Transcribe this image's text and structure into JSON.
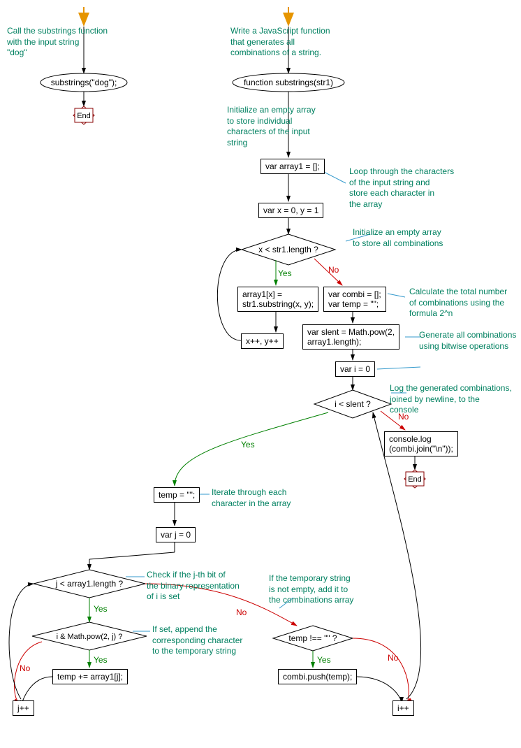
{
  "left_flow": {
    "ann1": "Call the substrings function\nwith the input string\n\"dog\"",
    "start": "substrings(\"dog\");",
    "end": "End"
  },
  "main": {
    "ann_title": "Write a JavaScript function\nthat generates all\ncombinations of a string.",
    "start": "function substrings(str1)",
    "ann_init_array": "Initialize an empty array\nto store individual\ncharacters of the input\nstring",
    "box_array1": "var array1 = [];",
    "ann_loop_chars": "Loop through the characters\nof the input string and\nstore each character in\nthe array",
    "box_xy": "var x = 0, y = 1",
    "dec_xlen": "x < str1.length ?",
    "yes": "Yes",
    "no": "No",
    "box_array_assign": "array1[x] =\nstr1.substring(x, y);",
    "box_xypp": "x++, y++",
    "ann_init_combi": "Initialize an empty array\nto store all combinations",
    "box_combi": "var combi = [];\nvar temp = \"\";",
    "ann_slent": "Calculate the total number\nof combinations using the\nformula 2^n",
    "box_slent": "var slent = Math.pow(2,\narray1.length);",
    "ann_gen": "Generate all combinations\nusing bitwise operations",
    "box_i0": "var i = 0",
    "dec_islent": "i < slent ?",
    "ann_log": "Log the generated combinations,\njoined by newline, to the\nconsole",
    "box_log": "console.log\n(combi.join(\"\\n\"));",
    "end": "End",
    "box_temp": "temp = \"\";",
    "ann_iter": "Iterate through each\ncharacter in the array",
    "box_j0": "var j = 0",
    "dec_jlen": "j < array1.length ?",
    "ann_checkbit": "Check if the j-th bit of\nthe binary representation\nof i is set",
    "dec_bit": "i & Math.pow(2, j) ?",
    "ann_append": "If set, append the\ncorresponding character\nto the temporary string",
    "box_append": "temp += array1[j];",
    "box_jpp": "j++",
    "ann_tempne": "If the temporary string\nis not empty, add it to\nthe combinations array",
    "dec_tempne": "temp !== \"\" ?",
    "box_push": "combi.push(temp);",
    "box_ipp": "i++"
  },
  "chart_data": {
    "type": "flowchart",
    "title": "JavaScript substrings/combinations flowchart",
    "nodes": [
      {
        "id": "A",
        "type": "terminator",
        "label": "substrings(\"dog\");"
      },
      {
        "id": "A_end",
        "type": "end",
        "label": "End"
      },
      {
        "id": "S",
        "type": "terminator",
        "label": "function substrings(str1)"
      },
      {
        "id": "N1",
        "type": "process",
        "label": "var array1 = [];"
      },
      {
        "id": "N2",
        "type": "process",
        "label": "var x = 0, y = 1"
      },
      {
        "id": "D1",
        "type": "decision",
        "label": "x < str1.length ?"
      },
      {
        "id": "N3",
        "type": "process",
        "label": "array1[x] = str1.substring(x, y);"
      },
      {
        "id": "N4",
        "type": "process",
        "label": "x++, y++"
      },
      {
        "id": "N5",
        "type": "process",
        "label": "var combi = []; var temp = \"\";"
      },
      {
        "id": "N6",
        "type": "process",
        "label": "var slent = Math.pow(2, array1.length);"
      },
      {
        "id": "N7",
        "type": "process",
        "label": "var i = 0"
      },
      {
        "id": "D2",
        "type": "decision",
        "label": "i < slent ?"
      },
      {
        "id": "N8",
        "type": "process",
        "label": "console.log(combi.join(\"\\n\"));"
      },
      {
        "id": "E2",
        "type": "end",
        "label": "End"
      },
      {
        "id": "N9",
        "type": "process",
        "label": "temp = \"\";"
      },
      {
        "id": "N10",
        "type": "process",
        "label": "var j = 0"
      },
      {
        "id": "D3",
        "type": "decision",
        "label": "j < array1.length ?"
      },
      {
        "id": "D4",
        "type": "decision",
        "label": "i & Math.pow(2, j) ?"
      },
      {
        "id": "N11",
        "type": "process",
        "label": "temp += array1[j];"
      },
      {
        "id": "N12",
        "type": "process",
        "label": "j++"
      },
      {
        "id": "D5",
        "type": "decision",
        "label": "temp !== \"\" ?"
      },
      {
        "id": "N13",
        "type": "process",
        "label": "combi.push(temp);"
      },
      {
        "id": "N14",
        "type": "process",
        "label": "i++"
      }
    ],
    "edges": [
      {
        "from": "A",
        "to": "A_end"
      },
      {
        "from": "S",
        "to": "N1"
      },
      {
        "from": "N1",
        "to": "N2"
      },
      {
        "from": "N2",
        "to": "D1"
      },
      {
        "from": "D1",
        "to": "N3",
        "label": "Yes"
      },
      {
        "from": "N3",
        "to": "N4"
      },
      {
        "from": "N4",
        "to": "D1"
      },
      {
        "from": "D1",
        "to": "N5",
        "label": "No"
      },
      {
        "from": "N5",
        "to": "N6"
      },
      {
        "from": "N6",
        "to": "N7"
      },
      {
        "from": "N7",
        "to": "D2"
      },
      {
        "from": "D2",
        "to": "N9",
        "label": "Yes"
      },
      {
        "from": "D2",
        "to": "N8",
        "label": "No"
      },
      {
        "from": "N8",
        "to": "E2"
      },
      {
        "from": "N9",
        "to": "N10"
      },
      {
        "from": "N10",
        "to": "D3"
      },
      {
        "from": "D3",
        "to": "D4",
        "label": "Yes"
      },
      {
        "from": "D4",
        "to": "N11",
        "label": "Yes"
      },
      {
        "from": "N11",
        "to": "N12"
      },
      {
        "from": "D4",
        "to": "N12",
        "label": "No"
      },
      {
        "from": "N12",
        "to": "D3"
      },
      {
        "from": "D3",
        "to": "D5",
        "label": "No"
      },
      {
        "from": "D5",
        "to": "N13",
        "label": "Yes"
      },
      {
        "from": "N13",
        "to": "N14"
      },
      {
        "from": "D5",
        "to": "N14",
        "label": "No"
      },
      {
        "from": "N14",
        "to": "D2"
      }
    ]
  }
}
